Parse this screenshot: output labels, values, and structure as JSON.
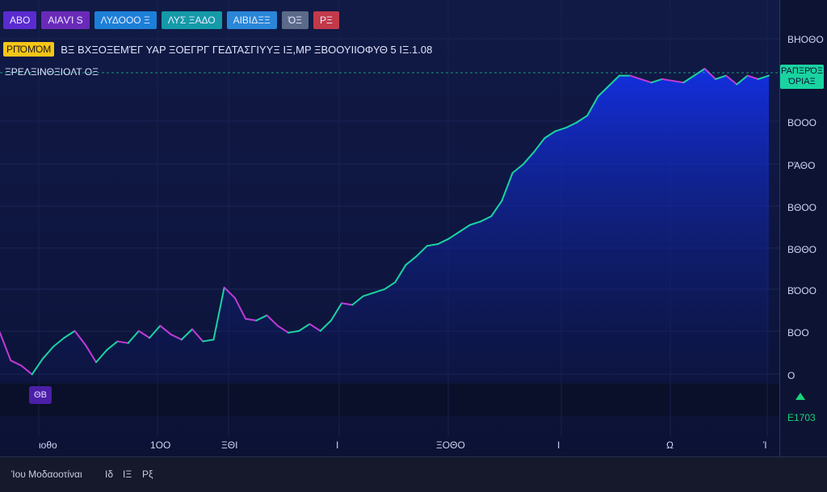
{
  "toolbar": {
    "buttons": [
      {
        "label": "ΑΒΟ",
        "bg": "#5a2bd0"
      },
      {
        "label": "ΑΙΑVΊ S",
        "bg": "#6a2ab8"
      },
      {
        "label": "ΛΥΔΟΟΟ Ξ",
        "bg": "#1d7fd8"
      },
      {
        "label": "ΛΥΣ ΞΑΔΟ",
        "bg": "#149aa8"
      },
      {
        "label": "ΑΙΒΙΔΞΞ",
        "bg": "#2a86d8"
      },
      {
        "label": "ΌΞ",
        "bg": "#5c6a8a"
      },
      {
        "label": "ΡΞ",
        "bg": "#c23a4a"
      }
    ]
  },
  "info": {
    "badge": "ΡΠΌΜΌΜ",
    "text": "ΒΞ ΒΧΞΟΞΕΜΈΓ ΥΑΡ ΞΟΕΓΡΓ ΓΕΔΤΑΣΓΙΥΥΞ ΙΞ,ΜΡ ΞΒΟΟΥΙΙΟΦΥΘ 5 ΙΞ.1.08"
  },
  "sub_label": "ΞΡΕΛΞΙΝΘΞΙΟΛΤ ΟΞ",
  "price_tag": {
    "line1": "ΡΑΠΞΡΌΞ",
    "line2": "ΌΡΙΑΞ"
  },
  "lower": {
    "marker": "ΘΒ",
    "value": "Ε1703"
  },
  "footer": {
    "left": "Ίου Μοδαοοτίναι",
    "mid1": "Ιδ",
    "mid2": "ΙΞ",
    "mid3": "Ρξ"
  },
  "colors": {
    "area_top": "#1330e8",
    "area_bottom": "#0d1a66",
    "line_main": "#19d4a0",
    "line_alt": "#c23ad8"
  },
  "chart_data": {
    "type": "area",
    "yticks": [
      "ΒΗΟΘΟ",
      "ΒΟΟΟ",
      "ΡΆΘΟ",
      "ΒΘΟΟ",
      "ΒΘΘΟ",
      "ΒΌΟΟ",
      "ΒΟΟ",
      "Ο"
    ],
    "xticks": [
      "ιοθο",
      "1ΟΟ",
      "ΞΘΙ",
      "Ι",
      "ΞΟΘΟ",
      "Ι",
      "Ω",
      "Ί"
    ],
    "ylim": [
      0,
      1000
    ],
    "values": [
      140,
      60,
      45,
      20,
      65,
      100,
      125,
      145,
      105,
      55,
      90,
      115,
      110,
      145,
      125,
      160,
      135,
      120,
      150,
      115,
      120,
      270,
      240,
      180,
      175,
      190,
      160,
      140,
      145,
      165,
      145,
      175,
      225,
      220,
      245,
      255,
      265,
      285,
      335,
      360,
      390,
      395,
      410,
      430,
      450,
      460,
      475,
      520,
      600,
      625,
      660,
      700,
      720,
      730,
      745,
      765,
      820,
      850,
      880,
      880,
      870,
      860,
      870,
      865,
      860,
      880,
      900,
      870,
      880,
      855,
      880,
      870,
      880
    ]
  }
}
